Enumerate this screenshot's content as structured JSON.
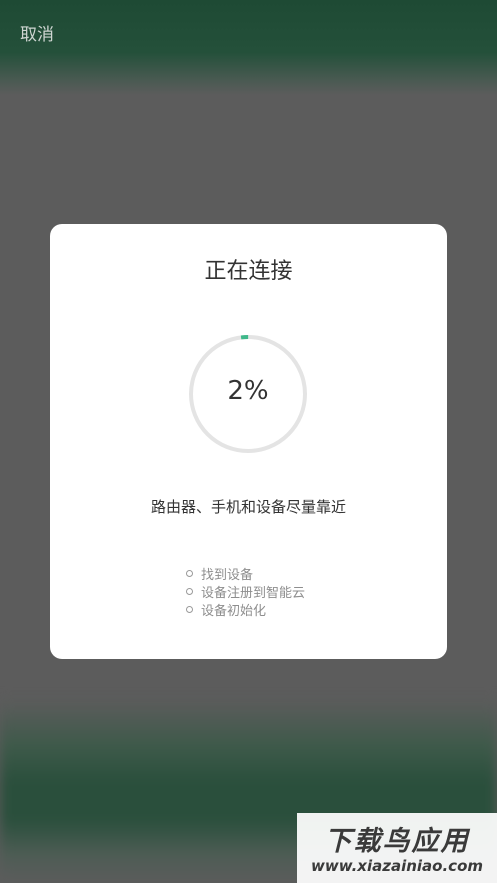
{
  "topbar": {
    "cancel_label": "取消"
  },
  "dialog": {
    "title": "正在连接",
    "progress": {
      "value_fraction": 0.02,
      "label": "2%"
    },
    "hint": "路由器、手机和设备尽量靠近",
    "steps": [
      "找到设备",
      "设备注册到智能云",
      "设备初始化"
    ]
  },
  "watermark": {
    "line1": "下载鸟应用",
    "line2": "www.xiazainiao.com"
  },
  "colors": {
    "accent": "#3fb88a",
    "ring_track": "#e4e4e4",
    "overlay": "#5c5c5c",
    "header_green": "#24503a"
  }
}
